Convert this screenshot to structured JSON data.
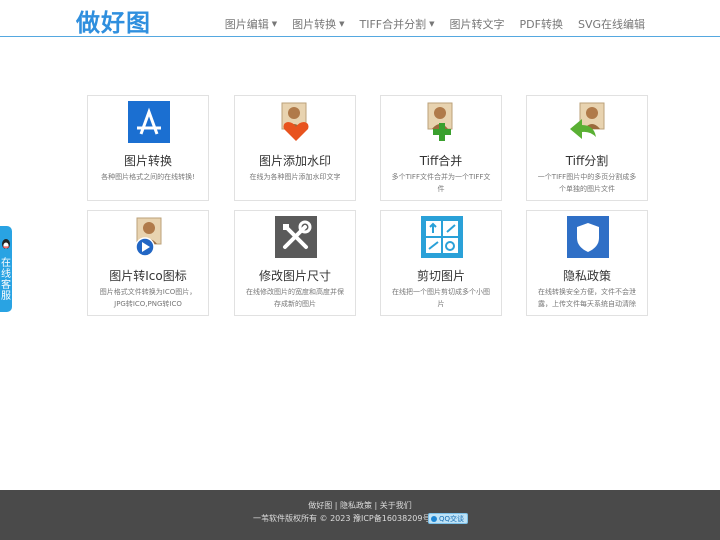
{
  "header": {
    "logo": "做好图",
    "nav": [
      {
        "label": "图片编辑",
        "dropdown": true
      },
      {
        "label": "图片转换",
        "dropdown": true
      },
      {
        "label": "TIFF合并分割",
        "dropdown": true
      },
      {
        "label": "图片转文字",
        "dropdown": false
      },
      {
        "label": "PDF转换",
        "dropdown": false
      },
      {
        "label": "SVG在线编辑",
        "dropdown": false
      }
    ]
  },
  "cards": [
    {
      "title": "图片转换",
      "desc": "各种图片格式之间的在线转换!",
      "icon": "app-store-icon"
    },
    {
      "title": "图片添加水印",
      "desc": "在线为各种图片添加水印文字",
      "icon": "photo-heart-icon"
    },
    {
      "title": "Tiff合并",
      "desc": "多个TIFF文件合并为一个TIFF文件",
      "icon": "photo-plus-icon"
    },
    {
      "title": "Tiff分割",
      "desc": "一个TIFF图片中的多页分割成多个单独的图片文件",
      "icon": "photo-arrow-icon"
    },
    {
      "title": "图片转Ico图标",
      "desc": "图片格式文件转换为ICO图片，JPG转ICO,PNG转ICO",
      "icon": "photo-play-icon"
    },
    {
      "title": "修改图片尺寸",
      "desc": "在线修改图片的宽度和高度并保存成新的图片",
      "icon": "tools-icon"
    },
    {
      "title": "剪切图片",
      "desc": "在线把一个图片剪切成多个小图片",
      "icon": "grid-tiles-icon"
    },
    {
      "title": "隐私政策",
      "desc": "在线转换安全方便，文件不会泄露，上传文件每天系统自动清除",
      "icon": "shield-icon"
    }
  ],
  "side_tab": {
    "label": "在线客服"
  },
  "footer": {
    "links": [
      "做好图",
      "隐私政策",
      "关于我们"
    ],
    "separator": "|",
    "copyright": "一苇软件版权所有 © 2023 豫ICP备16038209号-2",
    "qq_label": "QQ交谈"
  },
  "colors": {
    "accent": "#2f8fde",
    "header_line": "#55a8e0",
    "footer_bg": "#4a4a4a",
    "side_tab": "#29a3e3"
  }
}
